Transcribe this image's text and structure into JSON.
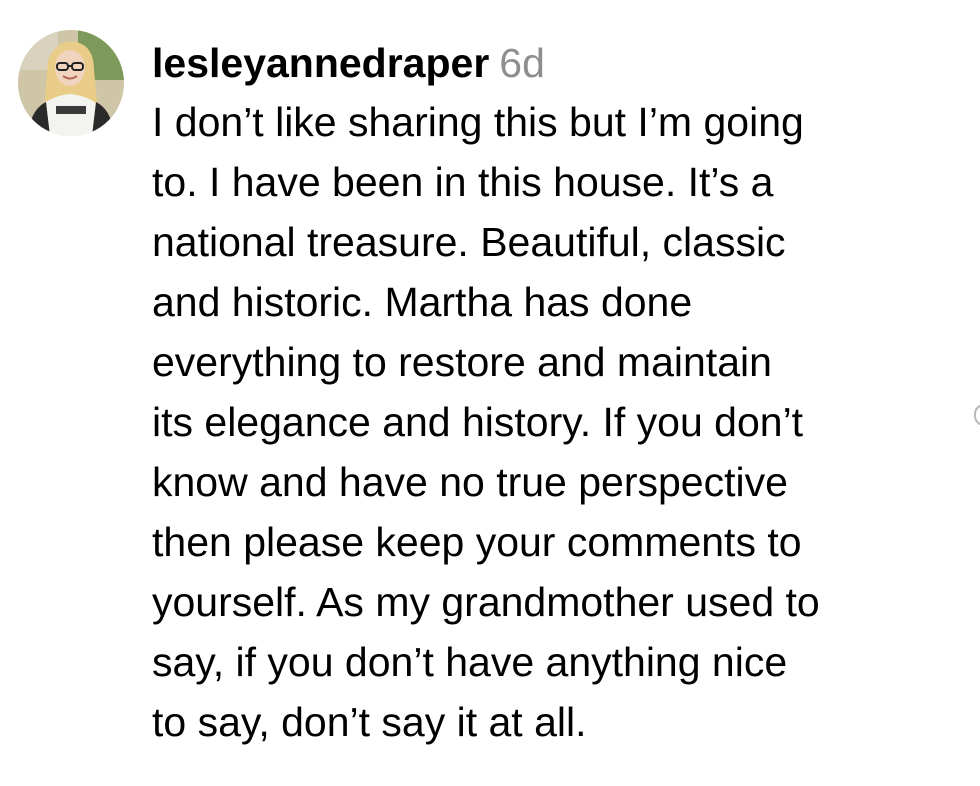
{
  "comment": {
    "avatar_icon": "user-avatar-photo",
    "username": "lesleyannedraper",
    "timestamp": "6d",
    "text_lines": [
      "I don’t like sharing this but I’m going",
      "to. I have been in this house. It’s a",
      "national treasure. Beautiful, classic",
      "and historic. Martha has done",
      "everything to restore and maintain",
      "its elegance and history. If you don’t",
      "know and have no true perspective",
      "then please keep your comments to",
      "yourself. As my grandmother used to",
      "say, if you don’t have anything nice",
      "to say, don’t say it at all."
    ],
    "colors": {
      "username": "#000000",
      "timestamp": "#8e8e8e",
      "text": "#000000",
      "background": "#ffffff"
    }
  }
}
